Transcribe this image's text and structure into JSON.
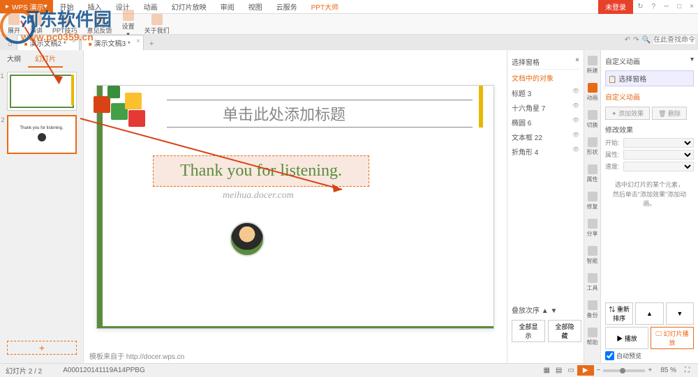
{
  "app": {
    "name": "WPS 演示",
    "login": "未登录"
  },
  "menu": [
    "开始",
    "插入",
    "设计",
    "动画",
    "幻灯片放映",
    "审阅",
    "视图",
    "云服务",
    "PPT大师"
  ],
  "ribbon": [
    "展开",
    "演讲",
    "PPT技巧",
    "意见反馈",
    "设置",
    "关于我们"
  ],
  "doctabs": [
    "演示文稿2 *",
    "演示文稿3 *"
  ],
  "left_tabs": {
    "outline": "大纲",
    "slides": "幻灯片"
  },
  "slide": {
    "title_placeholder": "单击此处添加标题",
    "thank": "Thank you for listening.",
    "subtitle": "meihua.docer.com"
  },
  "thumb2_text": "Thank you for listening.",
  "template_source": "模板来自于 http://docer.wps.cn",
  "select_panel": {
    "title": "选择窗格",
    "section": "文档中的对象",
    "items": [
      "标题 3",
      "十六角星 7",
      "椭圆 6",
      "文本框 22",
      "折角形 4"
    ],
    "order": "叠放次序",
    "show_all": "全部显示",
    "hide_all": "全部隐藏"
  },
  "tools": [
    "新建",
    "动画",
    "切换",
    "形状",
    "属性",
    "修复",
    "分享",
    "智能",
    "工具",
    "备份",
    "?",
    "帮助"
  ],
  "anim_panel": {
    "title": "自定义动画",
    "select_pane": "选择窗格",
    "section": "自定义动画",
    "modify": "修改效果",
    "add_effect": "添加效果",
    "remove": "删除",
    "start": "开始:",
    "property": "属性:",
    "speed": "速度:",
    "hint": "选中幻灯片的某个元素，然后单击\"添加效果\"添加动画。",
    "reorder": "重新排序",
    "play": "播放",
    "slideshow": "幻灯片播放",
    "autopreview": "自动预览"
  },
  "status": {
    "slide_count": "幻灯片 2 / 2",
    "template_id": "A000120141119A14PPBG",
    "zoom": "85 %"
  },
  "search_placeholder": "在此查找命令",
  "watermark": {
    "text": "河东软件园",
    "url": "www.pc0359.cn"
  }
}
